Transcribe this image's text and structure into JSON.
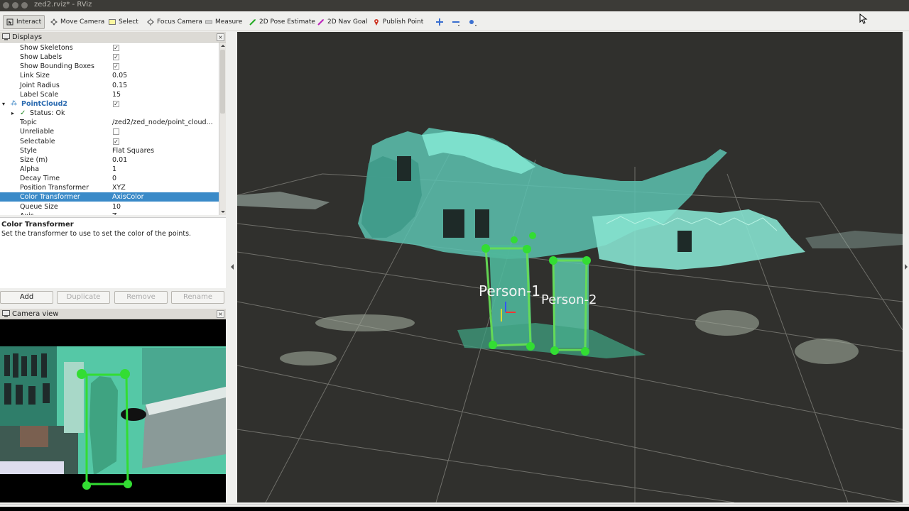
{
  "window": {
    "title": "zed2.rviz* - RViz"
  },
  "toolbar": {
    "tools": [
      {
        "label": "Interact",
        "icon": "interact-icon",
        "active": true
      },
      {
        "label": "Move Camera",
        "icon": "move-camera-icon"
      },
      {
        "label": "Select",
        "icon": "select-icon"
      },
      {
        "label": "Focus Camera",
        "icon": "focus-camera-icon"
      },
      {
        "label": "Measure",
        "icon": "measure-icon"
      },
      {
        "label": "2D Pose Estimate",
        "icon": "pose-estimate-icon"
      },
      {
        "label": "2D Nav Goal",
        "icon": "nav-goal-icon"
      },
      {
        "label": "Publish Point",
        "icon": "publish-point-icon"
      }
    ]
  },
  "displays": {
    "title": "Displays",
    "close": "×",
    "rows": [
      {
        "key": "Show Skeletons",
        "checked": true
      },
      {
        "key": "Show Labels",
        "checked": true
      },
      {
        "key": "Show Bounding Boxes",
        "checked": true
      },
      {
        "key": "Link Size",
        "value": "0.05"
      },
      {
        "key": "Joint Radius",
        "value": "0.15"
      },
      {
        "key": "Label Scale",
        "value": "15"
      },
      {
        "key": "PointCloud2",
        "checked": true,
        "group": true
      },
      {
        "key": "Status: Ok",
        "status": true
      },
      {
        "key": "Topic",
        "value": "/zed2/zed_node/point_cloud..."
      },
      {
        "key": "Unreliable",
        "checked": false
      },
      {
        "key": "Selectable",
        "checked": true
      },
      {
        "key": "Style",
        "value": "Flat Squares"
      },
      {
        "key": "Size (m)",
        "value": "0.01"
      },
      {
        "key": "Alpha",
        "value": "1"
      },
      {
        "key": "Decay Time",
        "value": "0"
      },
      {
        "key": "Position Transformer",
        "value": "XYZ"
      },
      {
        "key": "Color Transformer",
        "value": "AxisColor",
        "selected": true
      },
      {
        "key": "Queue Size",
        "value": "10"
      },
      {
        "key": "Axis",
        "value": "Z"
      }
    ]
  },
  "description": {
    "title": "Color Transformer",
    "text": "Set the transformer to use to set the color of the points."
  },
  "buttons": {
    "add": "Add",
    "duplicate": "Duplicate",
    "remove": "Remove",
    "rename": "Rename"
  },
  "camera_view": {
    "title": "Camera view",
    "close": "×"
  },
  "viewport": {
    "labels": [
      "Person-1",
      "Person-2"
    ]
  },
  "colors": {
    "selection": "#3a8ac8",
    "viewport_bg": "#30302d",
    "point_cloud": "#6fd9c4",
    "skeleton": "#33dd33"
  }
}
